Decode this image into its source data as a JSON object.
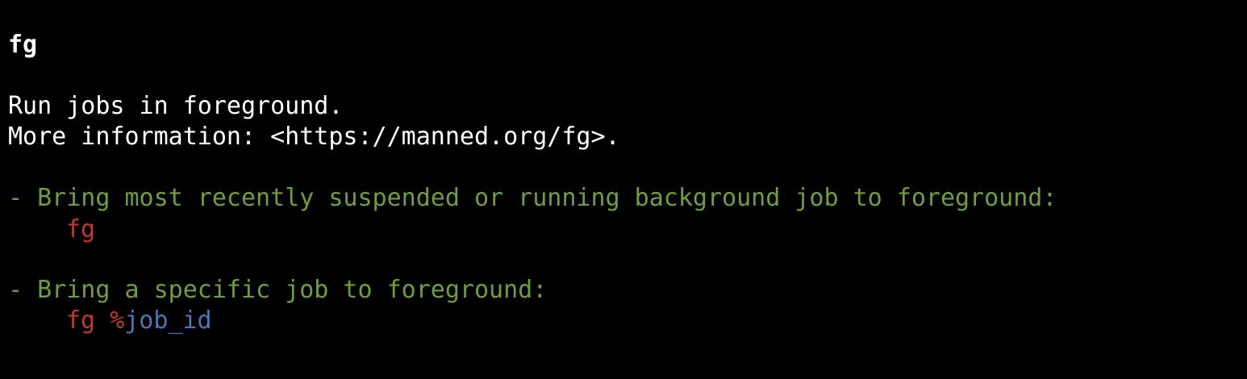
{
  "page": {
    "title": "fg",
    "description": "Run jobs in foreground.",
    "more_info": "More information: <https://manned.org/fg>."
  },
  "examples": [
    {
      "description": "- Bring most recently suspended or running background job to foreground:",
      "command": "fg"
    },
    {
      "description": "- Bring a specific job to foreground:",
      "command_prefix": "fg ",
      "command_symbol": "%",
      "command_placeholder": "job_id"
    }
  ],
  "colors": {
    "background": "#000000",
    "text": "#ffffff",
    "example_description": "#6f9e3c",
    "command": "#c0392b",
    "placeholder": "#4a76b8"
  }
}
